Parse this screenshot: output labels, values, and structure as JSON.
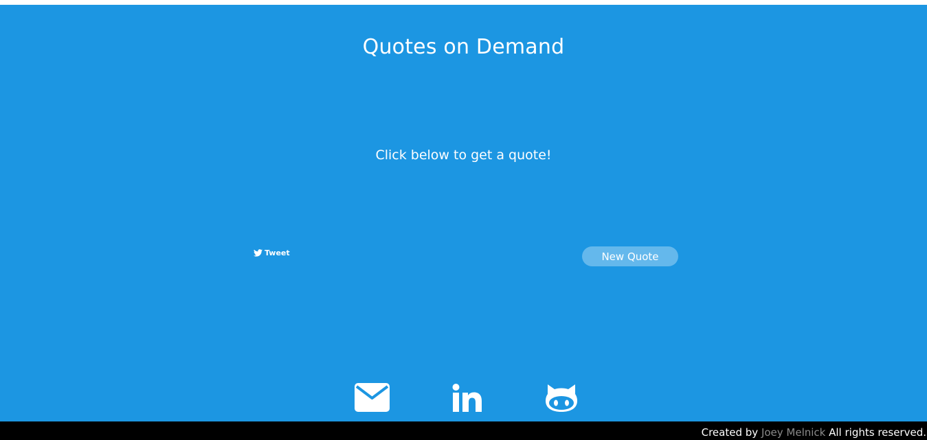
{
  "header": {
    "title": "Quotes on Demand"
  },
  "quote": {
    "text": "Click below to get a quote!"
  },
  "actions": {
    "tweet_label": "Tweet",
    "new_quote_label": "New Quote"
  },
  "social": {
    "icons": [
      "envelope-icon",
      "linkedin-icon",
      "github-icon"
    ]
  },
  "footer": {
    "prefix": "Created by ",
    "author": "Joey Melnick",
    "suffix": " All rights reserved."
  },
  "colors": {
    "background": "#1c96e2",
    "button": "#64b8ec",
    "footer_bg": "#000000",
    "footer_link": "#8a8a8a"
  }
}
